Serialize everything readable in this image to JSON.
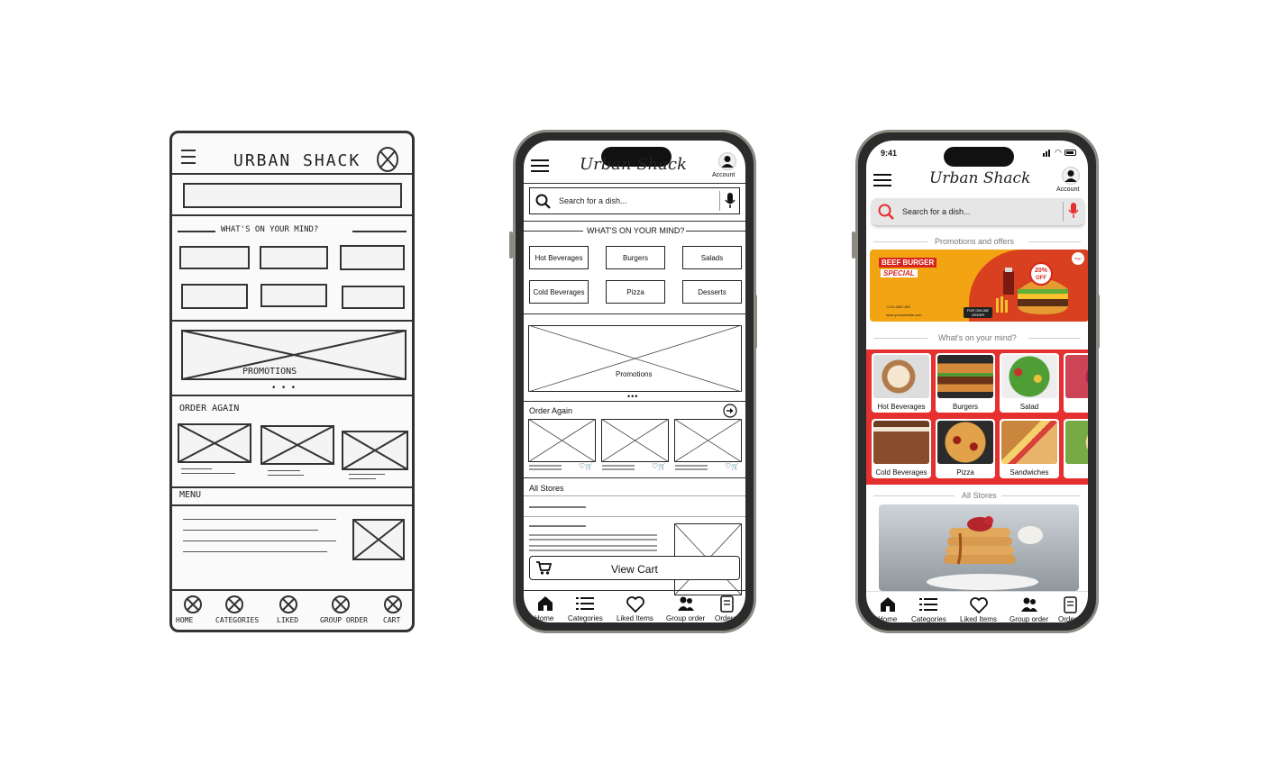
{
  "sketch": {
    "title": "URBAN SHACK",
    "whats_on_mind": "WHAT'S ON YOUR MIND?",
    "promotions": "PROMOTIONS",
    "dots": "• • •",
    "order_again": "ORDER AGAIN",
    "menu": "MENU",
    "nav": [
      "HOME",
      "CATEGORIES",
      "LIKED",
      "GROUP ORDER",
      "CART"
    ]
  },
  "wireframe": {
    "brand": "Urban Shack",
    "account": "Account",
    "search_placeholder": "Search for a dish...",
    "whats_on_mind": "WHAT'S ON YOUR MIND?",
    "categories": [
      "Hot Beverages",
      "Burgers",
      "Salads",
      "Cold Beverages",
      "Pizza",
      "Desserts"
    ],
    "promotions": "Promotions",
    "dots": "•••",
    "order_again": "Order Again",
    "all_stores": "All Stores",
    "view_cart": "View Cart",
    "nav": [
      "Home",
      "Categories",
      "Liked Items",
      "Group order",
      "Orders"
    ]
  },
  "hifi": {
    "time": "9:41",
    "brand": "Urban Shack",
    "account": "Account",
    "search_placeholder": "Search for a dish...",
    "promotions_title": "Promotions and offers",
    "banner": {
      "line1": "BEEF BURGER",
      "line2": "SPECIAL",
      "discount": "20%",
      "off": "OFF",
      "phone": "+123-4567-891",
      "website": "www.yourwebsite.com",
      "cta": "FOR ONLINE ORDER",
      "logo": "logo"
    },
    "whats_on_mind": "What's on your mind?",
    "categories": [
      "Hot Beverages",
      "Burgers",
      "Salad",
      "Cold Beverages",
      "Pizza",
      "Sandwiches"
    ],
    "all_stores": "All Stores",
    "nav": [
      "Home",
      "Categories",
      "Liked Items",
      "Group order",
      "Orders"
    ],
    "colors": {
      "accent": "#e53030",
      "banner_orange": "#f2a413",
      "grey_bar": "#e6e6e6"
    }
  }
}
